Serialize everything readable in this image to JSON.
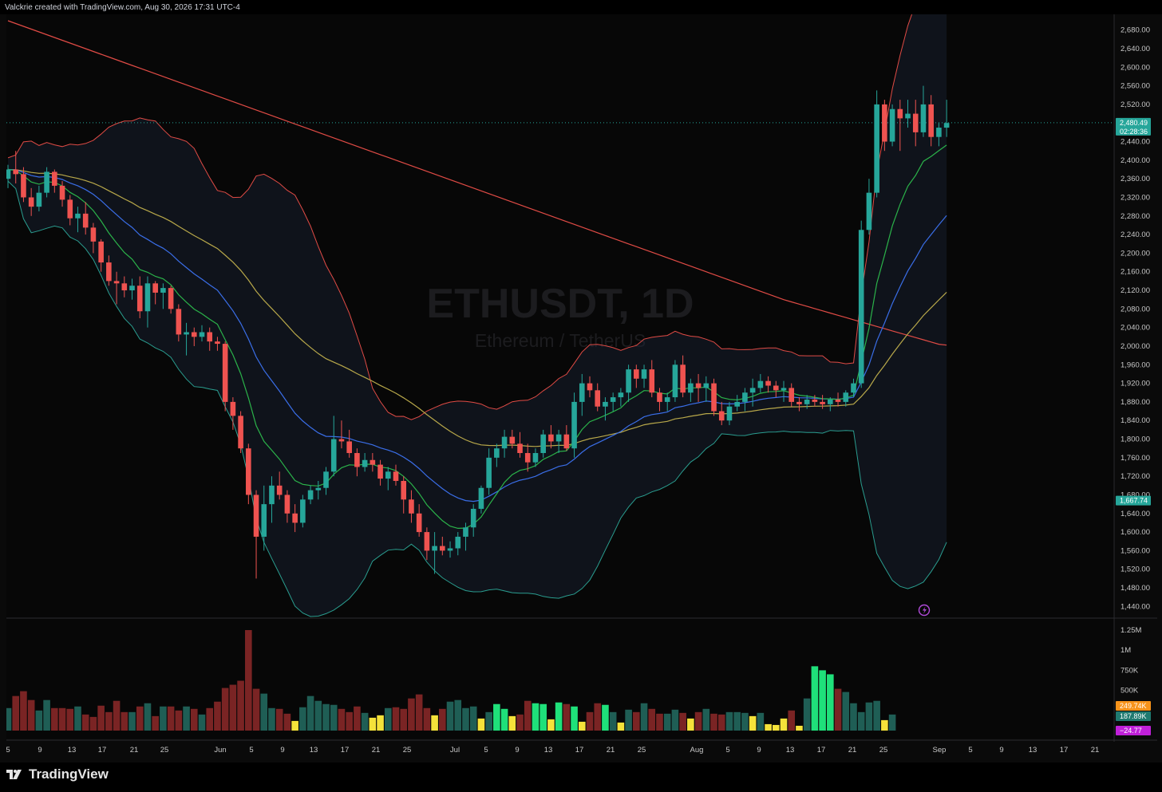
{
  "header": {
    "attribution": "Valckrie created with TradingView.com, Aug 30, 2026 17:31 UTC-4"
  },
  "brand": {
    "name": "TradingView"
  },
  "watermark": {
    "symbol": "ETHUSDT, 1D",
    "description": "Ethereum / TetherUS"
  },
  "colors": {
    "up": "#26a69a",
    "down": "#ef5350",
    "ema_green": "#2bb34a",
    "ema_blue": "#3a6ee8",
    "ma_yellow": "#b8a84a",
    "ma_red": "#e04b45",
    "bb_upper": "#e04b45",
    "bb_lower": "#2a9d8f"
  },
  "chart_data": {
    "type": "candlestick",
    "title": "ETHUSDT, 1D",
    "subtitle": "Ethereum / TetherUS",
    "price_axis": {
      "ticks": [
        "2,680.00",
        "2,640.00",
        "2,600.00",
        "2,560.00",
        "2,520.00",
        "2,480.00",
        "2,440.00",
        "2,400.00",
        "2,360.00",
        "2,320.00",
        "2,280.00",
        "2,240.00",
        "2,200.00",
        "2,160.00",
        "2,120.00",
        "2,080.00",
        "2,040.00",
        "2,000.00",
        "1,960.00",
        "1,920.00",
        "1,880.00",
        "1,840.00",
        "1,800.00",
        "1,760.00",
        "1,720.00",
        "1,680.00",
        "1,640.00",
        "1,600.00",
        "1,560.00",
        "1,520.00",
        "1,480.00",
        "1,440.00"
      ],
      "ylim": [
        1410,
        2695
      ]
    },
    "time_axis": {
      "ticks": [
        "5",
        "9",
        "13",
        "17",
        "21",
        "25",
        "Jun",
        "5",
        "9",
        "13",
        "17",
        "21",
        "25",
        "Jul",
        "5",
        "9",
        "13",
        "17",
        "21",
        "25",
        "Aug",
        "5",
        "9",
        "13",
        "17",
        "21",
        "25",
        "Sep",
        "5",
        "9",
        "13",
        "17",
        "21"
      ]
    },
    "last_price": "2,480.49",
    "countdown": "02:28:36",
    "level_label": "1,667.74",
    "candles": [
      [
        2360,
        2390,
        2340,
        2380
      ],
      [
        2380,
        2420,
        2350,
        2370
      ],
      [
        2370,
        2385,
        2310,
        2320
      ],
      [
        2320,
        2340,
        2280,
        2300
      ],
      [
        2300,
        2345,
        2290,
        2330
      ],
      [
        2330,
        2385,
        2320,
        2375
      ],
      [
        2375,
        2380,
        2330,
        2345
      ],
      [
        2345,
        2355,
        2300,
        2315
      ],
      [
        2315,
        2325,
        2260,
        2275
      ],
      [
        2275,
        2300,
        2245,
        2285
      ],
      [
        2285,
        2310,
        2240,
        2255
      ],
      [
        2255,
        2265,
        2200,
        2225
      ],
      [
        2225,
        2230,
        2160,
        2180
      ],
      [
        2180,
        2195,
        2130,
        2140
      ],
      [
        2140,
        2160,
        2090,
        2135
      ],
      [
        2135,
        2150,
        2105,
        2120
      ],
      [
        2120,
        2145,
        2100,
        2130
      ],
      [
        2130,
        2150,
        2060,
        2075
      ],
      [
        2075,
        2150,
        2040,
        2135
      ],
      [
        2135,
        2140,
        2090,
        2115
      ],
      [
        2115,
        2135,
        2080,
        2125
      ],
      [
        2125,
        2130,
        2070,
        2080
      ],
      [
        2080,
        2090,
        2010,
        2025
      ],
      [
        2025,
        2050,
        1980,
        2030
      ],
      [
        2030,
        2040,
        2000,
        2020
      ],
      [
        2020,
        2045,
        2010,
        2030
      ],
      [
        2030,
        2040,
        1990,
        2010
      ],
      [
        2010,
        2020,
        1990,
        2005
      ],
      [
        2005,
        2010,
        1860,
        1880
      ],
      [
        1880,
        1890,
        1820,
        1850
      ],
      [
        1850,
        1860,
        1770,
        1780
      ],
      [
        1780,
        1790,
        1660,
        1680
      ],
      [
        1680,
        1690,
        1500,
        1590
      ],
      [
        1590,
        1700,
        1560,
        1660
      ],
      [
        1660,
        1720,
        1620,
        1700
      ],
      [
        1700,
        1730,
        1670,
        1680
      ],
      [
        1680,
        1690,
        1620,
        1640
      ],
      [
        1640,
        1660,
        1600,
        1620
      ],
      [
        1620,
        1680,
        1610,
        1670
      ],
      [
        1670,
        1700,
        1660,
        1690
      ],
      [
        1690,
        1710,
        1670,
        1695
      ],
      [
        1695,
        1740,
        1680,
        1730
      ],
      [
        1730,
        1850,
        1720,
        1800
      ],
      [
        1800,
        1840,
        1780,
        1795
      ],
      [
        1795,
        1820,
        1760,
        1770
      ],
      [
        1770,
        1780,
        1720,
        1740
      ],
      [
        1740,
        1770,
        1730,
        1755
      ],
      [
        1755,
        1770,
        1730,
        1745
      ],
      [
        1745,
        1755,
        1700,
        1715
      ],
      [
        1715,
        1740,
        1690,
        1730
      ],
      [
        1730,
        1745,
        1700,
        1710
      ],
      [
        1710,
        1720,
        1640,
        1670
      ],
      [
        1670,
        1690,
        1620,
        1640
      ],
      [
        1640,
        1660,
        1590,
        1600
      ],
      [
        1600,
        1610,
        1540,
        1560
      ],
      [
        1560,
        1600,
        1510,
        1570
      ],
      [
        1570,
        1590,
        1550,
        1560
      ],
      [
        1560,
        1580,
        1545,
        1565
      ],
      [
        1565,
        1600,
        1550,
        1590
      ],
      [
        1590,
        1620,
        1560,
        1610
      ],
      [
        1610,
        1660,
        1590,
        1650
      ],
      [
        1650,
        1700,
        1640,
        1695
      ],
      [
        1695,
        1780,
        1680,
        1760
      ],
      [
        1760,
        1790,
        1740,
        1780
      ],
      [
        1780,
        1820,
        1760,
        1805
      ],
      [
        1805,
        1820,
        1780,
        1790
      ],
      [
        1790,
        1815,
        1760,
        1770
      ],
      [
        1770,
        1790,
        1730,
        1750
      ],
      [
        1750,
        1780,
        1740,
        1770
      ],
      [
        1770,
        1820,
        1760,
        1810
      ],
      [
        1810,
        1830,
        1780,
        1795
      ],
      [
        1795,
        1820,
        1770,
        1810
      ],
      [
        1810,
        1830,
        1775,
        1780
      ],
      [
        1780,
        1900,
        1760,
        1880
      ],
      [
        1880,
        1940,
        1850,
        1920
      ],
      [
        1920,
        1935,
        1890,
        1905
      ],
      [
        1905,
        1920,
        1860,
        1870
      ],
      [
        1870,
        1890,
        1840,
        1880
      ],
      [
        1880,
        1900,
        1860,
        1890
      ],
      [
        1890,
        1910,
        1870,
        1900
      ],
      [
        1900,
        1960,
        1880,
        1950
      ],
      [
        1950,
        1960,
        1910,
        1930
      ],
      [
        1930,
        1960,
        1910,
        1950
      ],
      [
        1950,
        1970,
        1890,
        1900
      ],
      [
        1900,
        1910,
        1860,
        1880
      ],
      [
        1880,
        1900,
        1860,
        1890
      ],
      [
        1890,
        1970,
        1880,
        1960
      ],
      [
        1960,
        1980,
        1890,
        1900
      ],
      [
        1900,
        1930,
        1880,
        1920
      ],
      [
        1920,
        1940,
        1880,
        1910
      ],
      [
        1910,
        1935,
        1880,
        1920
      ],
      [
        1920,
        1930,
        1850,
        1860
      ],
      [
        1860,
        1880,
        1830,
        1840
      ],
      [
        1840,
        1880,
        1830,
        1870
      ],
      [
        1870,
        1895,
        1860,
        1880
      ],
      [
        1880,
        1910,
        1860,
        1900
      ],
      [
        1900,
        1930,
        1870,
        1910
      ],
      [
        1910,
        1940,
        1900,
        1925
      ],
      [
        1925,
        1935,
        1900,
        1915
      ],
      [
        1915,
        1925,
        1890,
        1905
      ],
      [
        1905,
        1925,
        1880,
        1910
      ],
      [
        1910,
        1920,
        1870,
        1880
      ],
      [
        1880,
        1890,
        1860,
        1875
      ],
      [
        1875,
        1895,
        1865,
        1885
      ],
      [
        1885,
        1895,
        1870,
        1880
      ],
      [
        1880,
        1895,
        1865,
        1875
      ],
      [
        1875,
        1890,
        1860,
        1885
      ],
      [
        1885,
        1900,
        1870,
        1880
      ],
      [
        1880,
        1905,
        1870,
        1900
      ],
      [
        1900,
        1930,
        1890,
        1920
      ],
      [
        1920,
        2270,
        1910,
        2250
      ],
      [
        2250,
        2360,
        2240,
        2330
      ],
      [
        2330,
        2550,
        2320,
        2520
      ],
      [
        2520,
        2530,
        2420,
        2440
      ],
      [
        2440,
        2520,
        2430,
        2510
      ],
      [
        2510,
        2530,
        2420,
        2490
      ],
      [
        2490,
        2530,
        2470,
        2500
      ],
      [
        2500,
        2530,
        2430,
        2460
      ],
      [
        2460,
        2560,
        2450,
        2520
      ],
      [
        2520,
        2540,
        2430,
        2450
      ],
      [
        2450,
        2480,
        2430,
        2470
      ],
      [
        2470,
        2530,
        2450,
        2480
      ]
    ],
    "volume_axis": {
      "ticks": [
        "1.25M",
        "1M",
        "750K",
        "500K"
      ],
      "labels": [
        "249.74K",
        "187.89K",
        "−24.77"
      ]
    },
    "volume": [
      280,
      430,
      490,
      380,
      250,
      380,
      280,
      280,
      270,
      300,
      200,
      170,
      310,
      230,
      370,
      230,
      230,
      300,
      340,
      180,
      300,
      300,
      250,
      300,
      270,
      200,
      280,
      360,
      530,
      570,
      620,
      1250,
      520,
      460,
      280,
      270,
      210,
      120,
      290,
      430,
      370,
      330,
      320,
      270,
      230,
      300,
      220,
      160,
      190,
      280,
      290,
      270,
      400,
      450,
      280,
      190,
      270,
      360,
      380,
      280,
      300,
      150,
      230,
      330,
      270,
      180,
      200,
      370,
      340,
      330,
      140,
      350,
      330,
      300,
      110,
      230,
      340,
      320,
      230,
      100,
      260,
      230,
      340,
      270,
      210,
      210,
      260,
      220,
      150,
      230,
      270,
      210,
      200,
      230,
      230,
      220,
      180,
      220,
      80,
      70,
      150,
      250,
      60,
      400,
      800,
      750,
      700,
      520,
      480,
      340,
      230,
      350,
      370,
      130,
      200
    ]
  }
}
